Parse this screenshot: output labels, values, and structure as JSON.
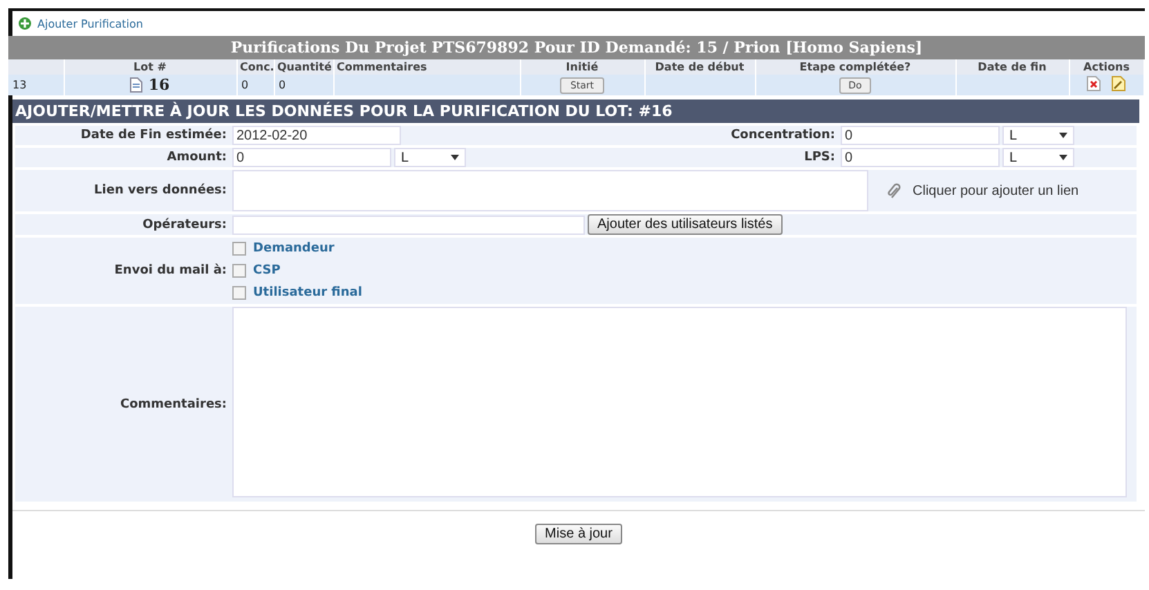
{
  "add_link": "Ajouter Purification",
  "table": {
    "title": "Purifications Du Projet PTS679892 Pour ID Demandé: 15 / Prion [Homo Sapiens]",
    "columns": [
      "Lot #",
      "Conc.",
      "Quantité",
      "Commentaires",
      "Initié",
      "Date de début",
      "Etape complétée?",
      "Date de fin",
      "Actions"
    ],
    "rows": [
      {
        "number": "13",
        "lot": "16",
        "conc": "0",
        "quantity": "0",
        "start_button": "Start",
        "complete_button": "Do"
      }
    ]
  },
  "form": {
    "title": "AJOUTER/METTRE À JOUR LES DONNÉES POUR LA PURIFICATION DU LOT: #16",
    "end_date": {
      "label": "Date de Fin estimée:",
      "value": "2012-02-20"
    },
    "concentration": {
      "label": "Concentration:",
      "value": "0",
      "unit": "L"
    },
    "amount": {
      "label": "Amount:",
      "value": "0",
      "unit": "L"
    },
    "lps": {
      "label": "LPS:",
      "value": "0",
      "unit": "L"
    },
    "link": {
      "label": "Lien vers données:",
      "hint": "Cliquer pour ajouter un lien"
    },
    "operators": {
      "label": "Opérateurs:",
      "button": "Ajouter des utilisateurs listés"
    },
    "mail": {
      "label": "Envoi du mail à:",
      "options": [
        {
          "label": "Demandeur",
          "checked": false
        },
        {
          "label": "CSP",
          "checked": false
        },
        {
          "label": "Utilisateur final",
          "checked": false
        }
      ]
    },
    "comments": {
      "label": "Commentaires:"
    },
    "submit": "Mise à jour"
  }
}
